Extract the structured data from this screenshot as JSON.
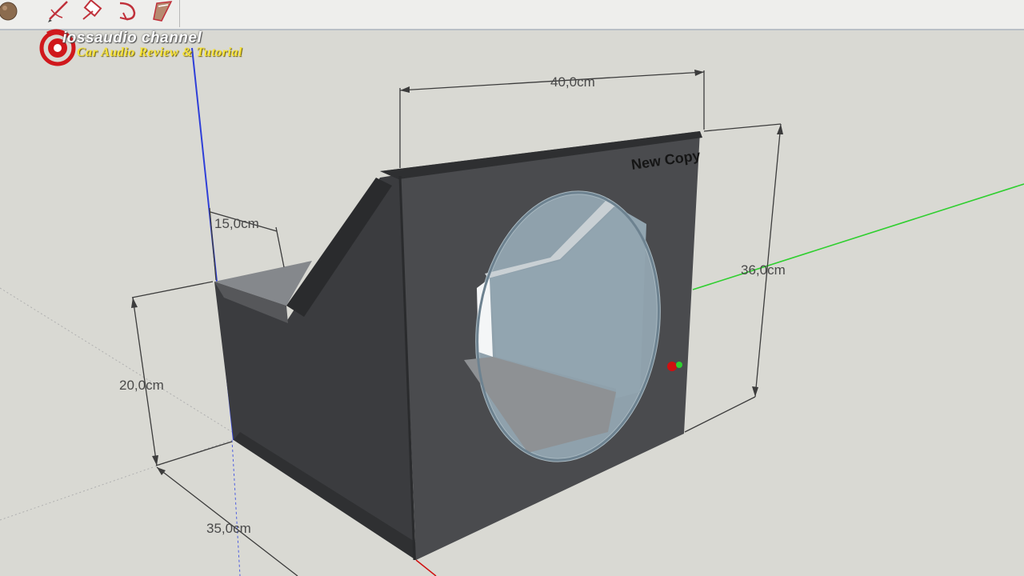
{
  "toolbar": {
    "tools": [
      {
        "name": "orbit-tool",
        "icon": "sphere-icon"
      },
      {
        "name": "pencil-tool",
        "icon": "pencil-icon"
      },
      {
        "name": "eraser-tool",
        "icon": "eraser-icon"
      },
      {
        "name": "tape-measure-tool",
        "icon": "tape-measure-icon"
      },
      {
        "name": "paint-bucket-tool",
        "icon": "paint-bucket-icon"
      }
    ]
  },
  "watermark": {
    "title": "iossaudio channel",
    "subtitle": "Car Audio Review & Tutorial"
  },
  "dimensions": {
    "width": "40,0cm",
    "height": "36,0cm",
    "top_depth": "15,0cm",
    "side_height": "20,0cm",
    "depth": "35,0cm"
  },
  "model": {
    "label": "New Copy"
  },
  "colors": {
    "background": "#d9d9d3",
    "box_face": "#4a4b4e",
    "box_side": "#3b3c3f",
    "box_top": "#2e2f31",
    "interior": "#8fa1ac",
    "blue_axis": "#2f3fd8",
    "green_axis": "#2fcf2f",
    "red_axis": "#d01010",
    "watermark_text": "#ffffff",
    "watermark_sub": "#f6e23a",
    "logo_red": "#d0181c"
  }
}
